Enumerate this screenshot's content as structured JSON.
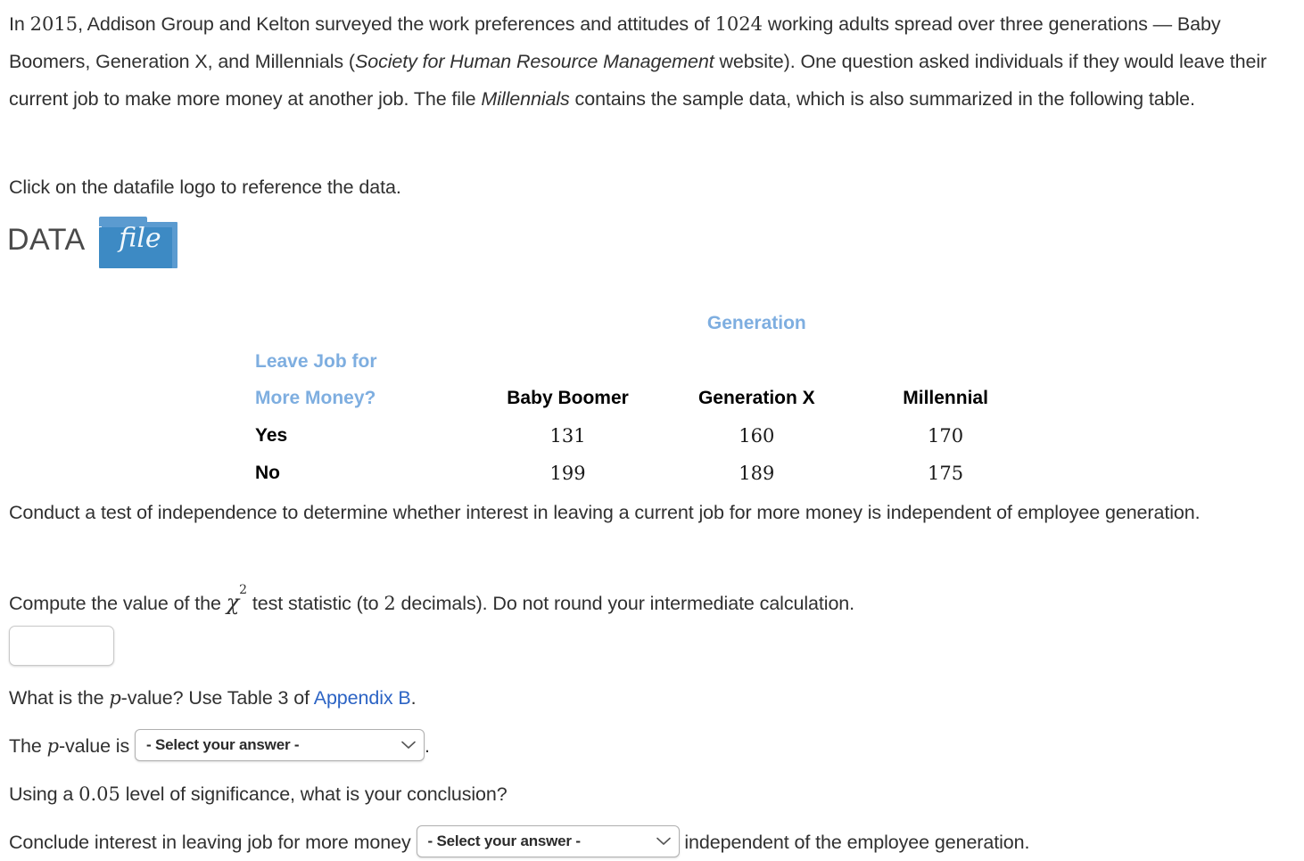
{
  "intro": {
    "s1": "In ",
    "year": "2015",
    "s2": ", Addison Group and Kelton surveyed the work preferences and attitudes of ",
    "sample_size": "1024",
    "s3": " working adults spread over three generations — Baby Boomers, Generation X, and Millennials (",
    "source_italic": "Society for Human Resource Management",
    "s4": " website). One question asked individuals if they would leave their current job to make more money at another job. The file ",
    "file_italic": "Millennials",
    "s5": " contains the sample data, which is also summarized in the following table."
  },
  "datafile": {
    "instruction": "Click on the datafile logo to reference the data.",
    "logo_word_left": "DATA",
    "logo_word_right": "file"
  },
  "table": {
    "group_header": "Generation",
    "row_header_line1": "Leave Job for",
    "row_header_line2": "More Money?",
    "columns": [
      "Baby Boomer",
      "Generation X",
      "Millennial"
    ],
    "rows": [
      {
        "label": "Yes",
        "values": [
          "131",
          "160",
          "170"
        ]
      },
      {
        "label": "No",
        "values": [
          "199",
          "189",
          "175"
        ]
      }
    ],
    "header_color": "#7EAEE0"
  },
  "prompts": {
    "conduct": "Conduct a test of independence to determine whether interest in leaving a current job for more money is independent of employee generation.",
    "compute_s1": "Compute the value of the ",
    "compute_symbol": "χ",
    "compute_exponent": "2",
    "compute_s2": " test statistic (to ",
    "compute_decimals": "2",
    "compute_s3": " decimals). Do not round your intermediate calculation.",
    "pvalue_q_s1": "What is the ",
    "pvalue_q_p": "p",
    "pvalue_q_s2": "-value? Use Table 3 of ",
    "pvalue_q_link": "Appendix B",
    "pvalue_q_s3": ".",
    "pvalue_a_s1": "The ",
    "pvalue_a_p": "p",
    "pvalue_a_s2": "-value is ",
    "pvalue_a_s3": ".",
    "significance_s1": "Using a ",
    "significance_alpha": "0.05",
    "significance_s2": " level of significance, what is your conclusion?",
    "conclusion_s1": "Conclude interest in leaving job for more money ",
    "conclusion_s2": " independent of the employee generation."
  },
  "inputs": {
    "chi_value": "",
    "chi_placeholder": ""
  },
  "selects": {
    "pvalue_selected": "- Select your answer -",
    "conclusion_selected": "- Select your answer -"
  },
  "colors": {
    "link": "#2B63C4",
    "table_header_blue": "#7EAEE0",
    "folder_blue": "#3D8AC4",
    "text": "#303030"
  }
}
